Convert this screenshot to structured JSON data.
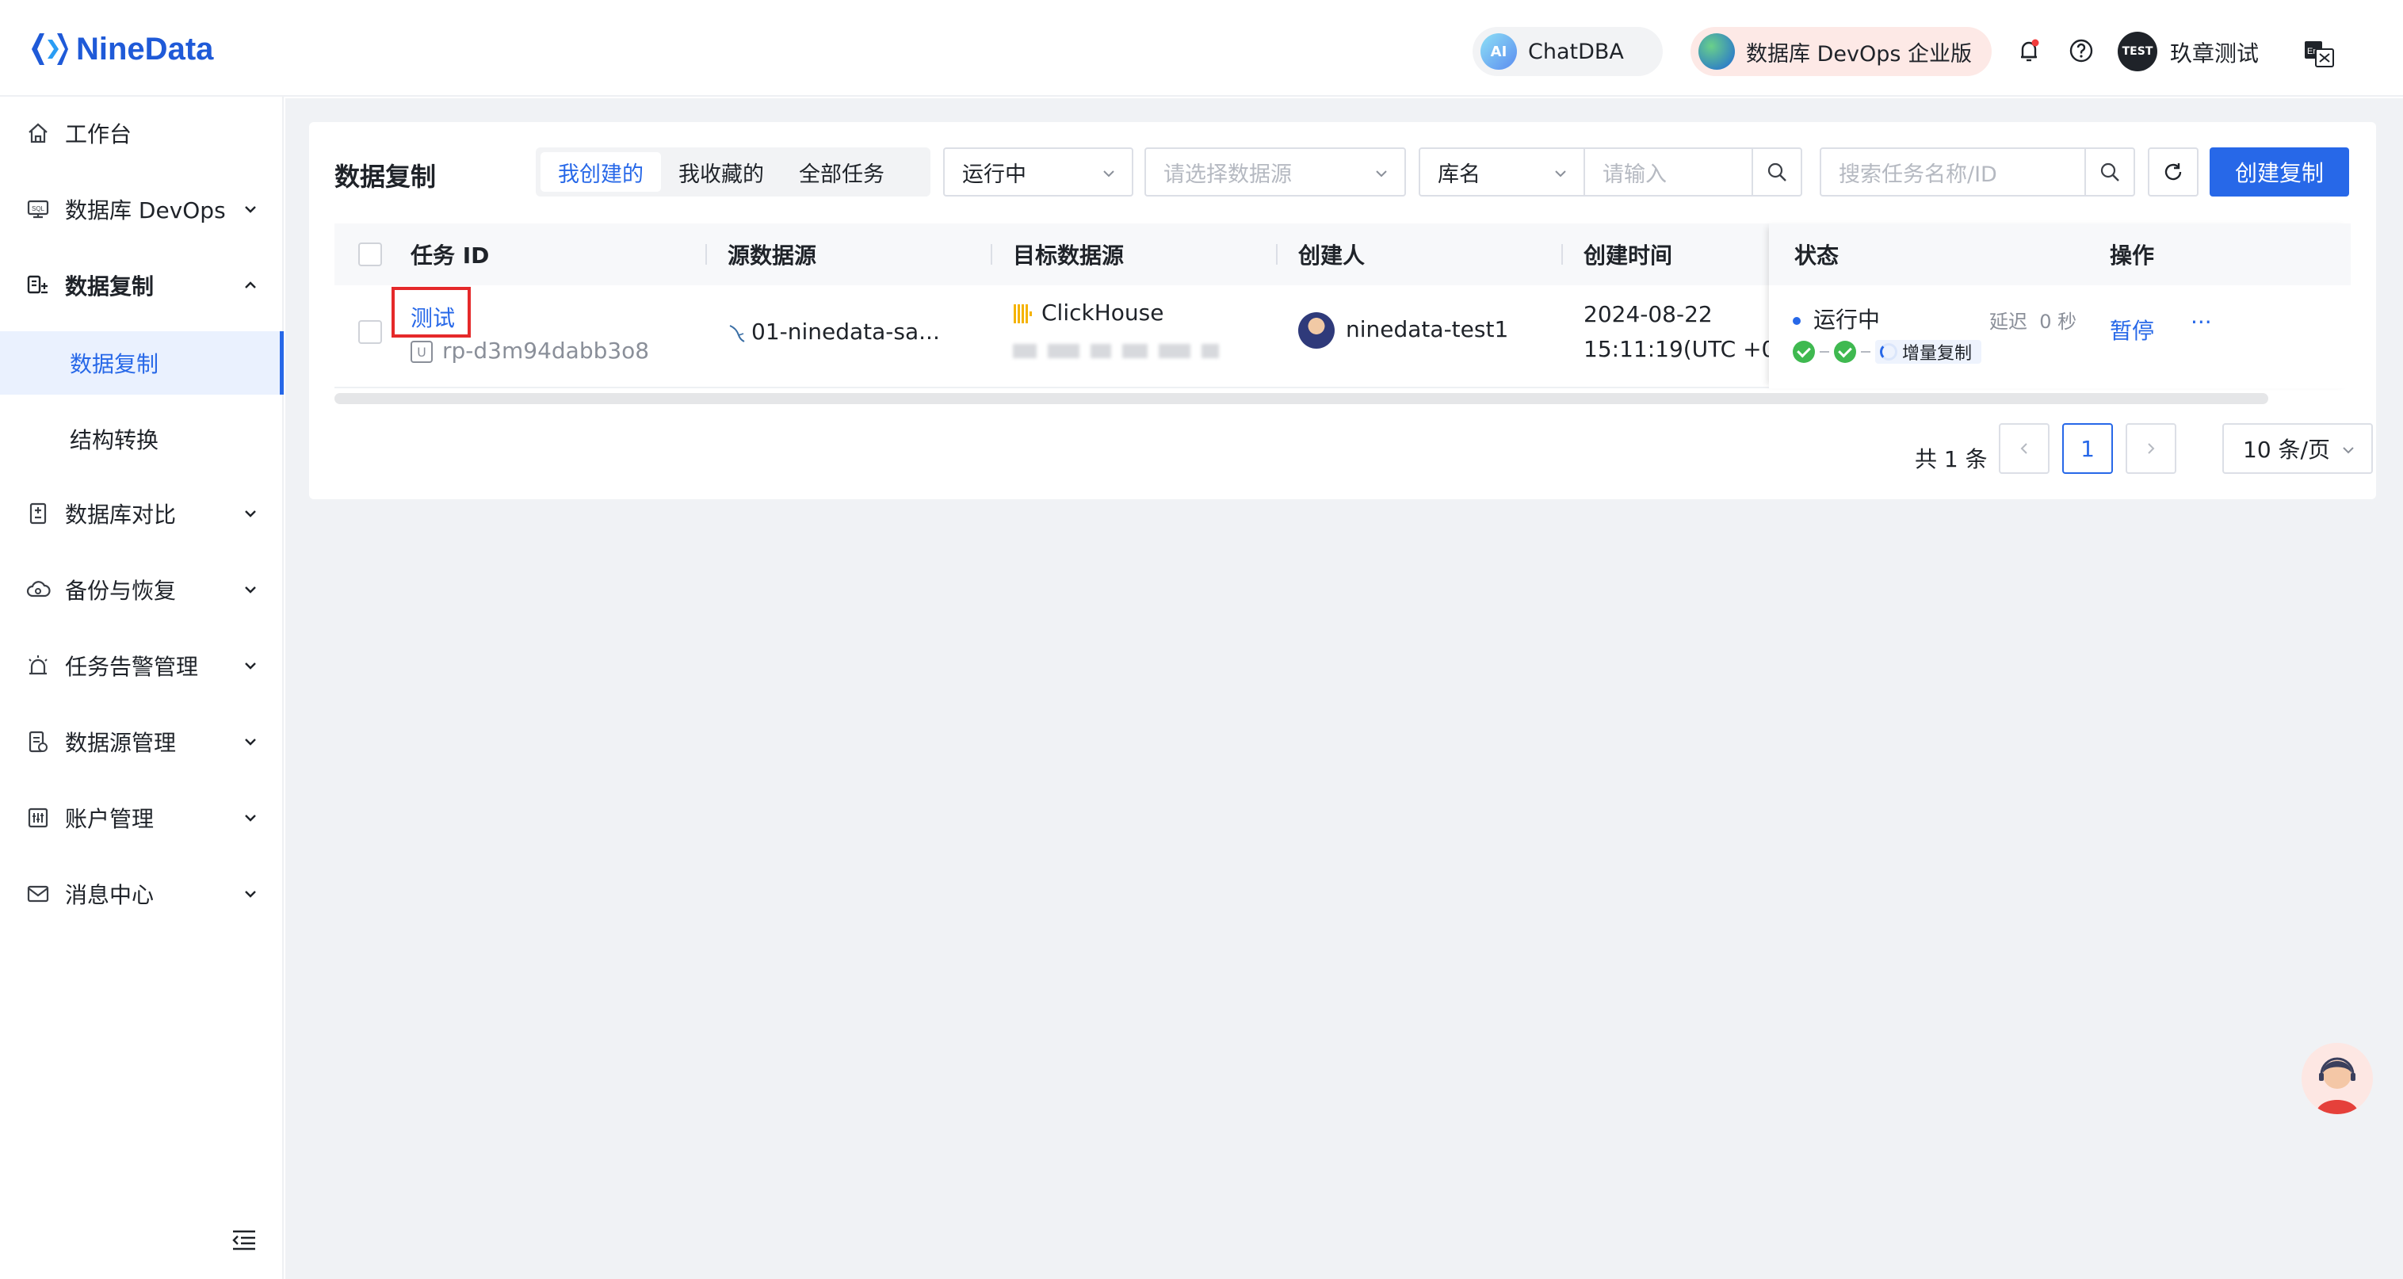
{
  "app": {
    "logo_text": "NineData"
  },
  "topbar": {
    "chatdba_badge": "AI",
    "chatdba_label": "ChatDBA",
    "devops_label": "数据库 DevOps 企业版",
    "user_avatar": "TEST",
    "user_name": "玖章测试"
  },
  "sidebar": {
    "items": [
      {
        "label": "工作台",
        "icon": "home-icon"
      },
      {
        "label": "数据库 DevOps",
        "icon": "devops-icon"
      },
      {
        "label": "数据复制",
        "icon": "replication-icon"
      },
      {
        "label": "数据库对比",
        "icon": "compare-icon"
      },
      {
        "label": "备份与恢复",
        "icon": "backup-icon"
      },
      {
        "label": "任务告警管理",
        "icon": "alarm-icon"
      },
      {
        "label": "数据源管理",
        "icon": "datasource-icon"
      },
      {
        "label": "账户管理",
        "icon": "account-icon"
      },
      {
        "label": "消息中心",
        "icon": "mail-icon"
      }
    ],
    "sub_items": [
      {
        "label": "数据复制",
        "active": true
      },
      {
        "label": "结构转换",
        "active": false
      }
    ]
  },
  "toolbar": {
    "title": "数据复制",
    "tabs": [
      "我创建的",
      "我收藏的",
      "全部任务"
    ],
    "status_value": "运行中",
    "datasource_placeholder": "请选择数据源",
    "field_value": "库名",
    "input_placeholder": "请输入",
    "search_placeholder": "搜索任务名称/ID",
    "create_label": "创建复制"
  },
  "table": {
    "columns": [
      "任务 ID",
      "源数据源",
      "目标数据源",
      "创建人",
      "创建时间",
      "状态",
      "操作"
    ],
    "rows": [
      {
        "task_name": "测试",
        "id_badge": "U",
        "task_id": "rp-d3m94dabb3o8",
        "source": "01-ninedata-sa...",
        "target": "ClickHouse",
        "creator": "ninedata-test1",
        "created_date": "2024-08-22",
        "created_time": "15:11:19(UTC +0",
        "status": "运行中",
        "delay_label": "延迟",
        "delay_value": "0 秒",
        "phase": "增量复制",
        "action": "暂停",
        "more": "···"
      }
    ]
  },
  "pagination": {
    "total": "共 1 条",
    "current_page": "1",
    "page_size": "10 条/页"
  },
  "colors": {
    "primary": "#2768e8",
    "highlight_box": "#e5292a",
    "success": "#3fb950"
  }
}
